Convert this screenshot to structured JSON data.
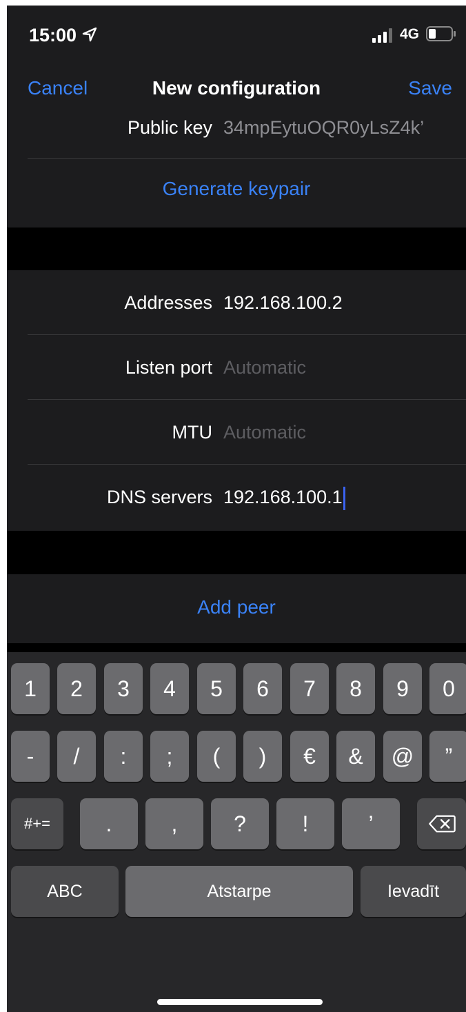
{
  "status": {
    "time": "15:00",
    "network": "4G"
  },
  "nav": {
    "cancel": "Cancel",
    "title": "New configuration",
    "save": "Save"
  },
  "interface": {
    "public_key_label": "Public key",
    "public_key_value": "34mpEytuOQR0yLsZ4k’",
    "generate_keypair": "Generate keypair"
  },
  "settings": {
    "addresses_label": "Addresses",
    "addresses_value": "192.168.100.2",
    "listen_port_label": "Listen port",
    "listen_port_placeholder": "Automatic",
    "mtu_label": "MTU",
    "mtu_placeholder": "Automatic",
    "dns_label": "DNS servers",
    "dns_value": "192.168.100.1"
  },
  "peer": {
    "add_peer": "Add peer"
  },
  "keyboard": {
    "row1": [
      "1",
      "2",
      "3",
      "4",
      "5",
      "6",
      "7",
      "8",
      "9",
      "0"
    ],
    "row2": [
      "-",
      "/",
      ":",
      ";",
      "(",
      ")",
      "€",
      "&",
      "@",
      "”"
    ],
    "row3": [
      ".",
      ",",
      "?",
      "!",
      "’"
    ],
    "symbols_key": "#+=",
    "abc_key": "ABC",
    "space_key": "Atstarpe",
    "return_key": "Ievadīt"
  }
}
